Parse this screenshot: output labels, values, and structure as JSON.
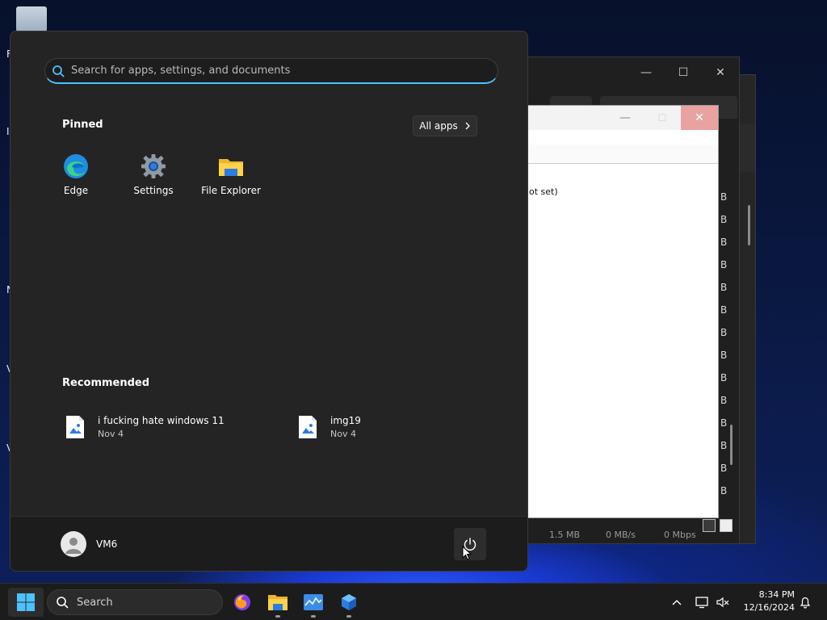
{
  "search": {
    "placeholder": "Search for apps, settings, and documents"
  },
  "pinned": {
    "title": "Pinned",
    "all_apps_label": "All apps",
    "apps": [
      {
        "label": "Edge",
        "icon": "edge-icon"
      },
      {
        "label": "Settings",
        "icon": "gear-icon"
      },
      {
        "label": "File Explorer",
        "icon": "folder-icon"
      }
    ]
  },
  "recommended": {
    "title": "Recommended",
    "items": [
      {
        "name": "i fucking hate windows 11",
        "date": "Nov 4",
        "icon": "image-file-icon"
      },
      {
        "name": "img19",
        "date": "Nov 4",
        "icon": "image-file-icon"
      }
    ]
  },
  "user": {
    "name": "VM6"
  },
  "taskbar": {
    "search_label": "Search",
    "time": "8:34 PM",
    "date": "12/16/2024"
  },
  "background": {
    "not_set_text": "ot set)",
    "b_label": "B",
    "status": [
      "1.5 MB",
      "0 MB/s",
      "0 Mbps"
    ]
  },
  "colors": {
    "accent": "#4cc2ff",
    "menu_bg": "#242424",
    "taskbar_bg": "#1c1c1c"
  }
}
